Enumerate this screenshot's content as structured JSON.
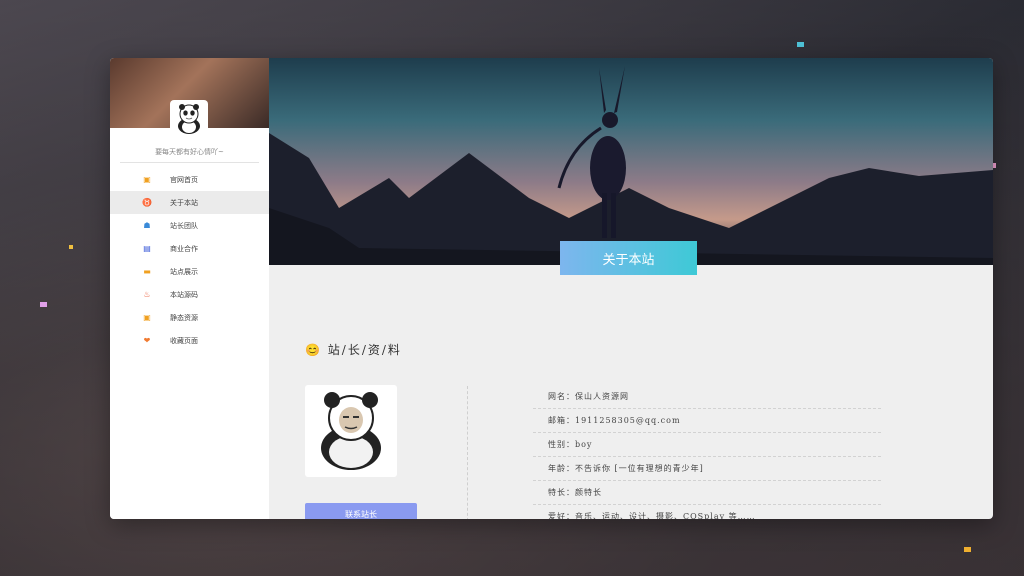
{
  "sidebar": {
    "motto": "要每天都有好心情吖~",
    "items": [
      {
        "label": "官网首页",
        "icon": "home-icon",
        "glyph": "▣",
        "color": "#f0a020"
      },
      {
        "label": "关于本站",
        "icon": "alarm-icon",
        "glyph": "♉",
        "color": "#f07a30",
        "active": true
      },
      {
        "label": "站长团队",
        "icon": "team-icon",
        "glyph": "☗",
        "color": "#3a8ad8"
      },
      {
        "label": "商业合作",
        "icon": "business-icon",
        "glyph": "▤",
        "color": "#3a5ad8"
      },
      {
        "label": "站点展示",
        "icon": "folder-icon",
        "glyph": "▬",
        "color": "#f0a020"
      },
      {
        "label": "本站源码",
        "icon": "fire-icon",
        "glyph": "♨",
        "color": "#e8502a"
      },
      {
        "label": "静态资源",
        "icon": "box-icon",
        "glyph": "▣",
        "color": "#f0a020"
      },
      {
        "label": "收藏页面",
        "icon": "heart-icon",
        "glyph": "❤",
        "color": "#f07a30"
      }
    ]
  },
  "banner": {
    "title": "关于本站"
  },
  "profile": {
    "section_title": "站/长/资/料",
    "section_emoji": "😊",
    "contact_label": "联系站长",
    "info": [
      "网名：保山人资源网",
      "邮箱：1911258305@qq.com",
      "性别：boy",
      "年龄：不告诉你 [一位有理想的青少年]",
      "特长：颜特长",
      "爱好：音乐、运动、设计、摄影、COSplay 等……"
    ]
  },
  "colors": {
    "title_gradient_start": "#7db6ee",
    "title_gradient_end": "#3ec9d6",
    "contact_button": "#8a9af0"
  }
}
